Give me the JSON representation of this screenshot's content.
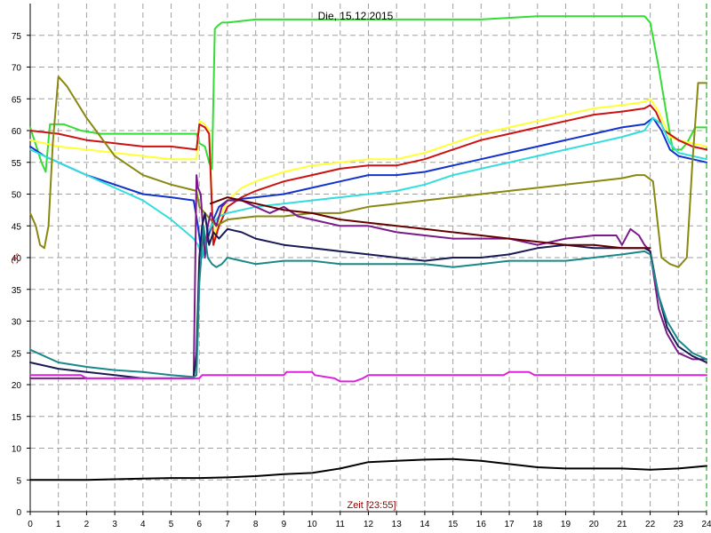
{
  "chart_data": {
    "type": "line",
    "title": "Die, 15.12.2015",
    "xlabel": "Zeit [23:55]",
    "ylabel": "°C",
    "xlim": [
      0,
      24
    ],
    "ylim": [
      0,
      80
    ],
    "x_ticks": [
      "0",
      "1",
      "2",
      "3",
      "4",
      "5",
      "6",
      "7",
      "8",
      "9",
      "10",
      "11",
      "12",
      "13",
      "14",
      "15",
      "16",
      "17",
      "18",
      "19",
      "20",
      "21",
      "22",
      "23",
      "24"
    ],
    "y_ticks": [
      "0",
      "5",
      "10",
      "15",
      "20",
      "25",
      "30",
      "35",
      "40",
      "45",
      "50",
      "55",
      "60",
      "65",
      "70",
      "75"
    ],
    "grid": true,
    "background": "#ffffff",
    "axis_color": "#000000",
    "grid_color": "#a0a0a0",
    "series": [
      {
        "color": "#33dd33",
        "x": [
          0,
          0.4,
          0.55,
          0.7,
          1.2,
          1.8,
          2.5,
          3,
          4,
          5,
          5.9,
          6.0,
          6.2,
          6.35,
          6.45,
          6.55,
          6.65,
          6.8,
          7,
          8,
          10,
          12,
          14,
          16,
          18,
          20,
          21,
          21.8,
          22.0,
          22.3,
          22.6,
          22.8,
          23.1,
          23.3,
          23.6,
          24
        ],
        "y": [
          60.5,
          55,
          53.5,
          61,
          61,
          60,
          59.5,
          59.5,
          59.5,
          59.5,
          59.5,
          58,
          57.5,
          55,
          54,
          76,
          76.5,
          77,
          77,
          77.5,
          77.5,
          77.5,
          77.5,
          77.5,
          78,
          78,
          78,
          78,
          77,
          70,
          62,
          57,
          57,
          58,
          60.5,
          60.5
        ]
      },
      {
        "color": "#ffff33",
        "x": [
          0,
          1,
          2,
          3,
          4,
          5,
          5.9,
          6.0,
          6.2,
          6.35,
          6.5,
          6.7,
          7,
          7.5,
          8,
          9,
          10,
          11,
          12,
          13,
          14,
          15,
          16,
          17,
          18,
          19,
          20,
          21,
          21.8,
          22.0,
          22.3,
          22.7,
          23,
          23.5,
          24
        ],
        "y": [
          58.5,
          57.5,
          57,
          56.5,
          56,
          55.5,
          55.5,
          61.5,
          61,
          60,
          43,
          46,
          49,
          51,
          52,
          53.5,
          54.5,
          55,
          55.5,
          55.5,
          56.5,
          58,
          59.5,
          60.5,
          61.5,
          62.5,
          63.5,
          64,
          64.5,
          65,
          63,
          59,
          58.5,
          58,
          57.5
        ]
      },
      {
        "color": "#cc1111",
        "x": [
          0,
          1,
          2,
          3,
          4,
          5,
          5.9,
          6.0,
          6.2,
          6.35,
          6.5,
          6.7,
          7,
          7.5,
          8,
          9,
          10,
          11,
          12,
          13,
          14,
          15,
          16,
          17,
          18,
          19,
          20,
          21,
          21.8,
          22.0,
          22.2,
          22.5,
          23,
          23.5,
          24
        ],
        "y": [
          60,
          59.5,
          58.5,
          58,
          57.5,
          57.5,
          57,
          61,
          60.5,
          59.5,
          42,
          45,
          48,
          49.5,
          50.5,
          52,
          53,
          54,
          54.5,
          54.5,
          55.5,
          57,
          58.5,
          59.5,
          60.5,
          61.5,
          62.5,
          63,
          63.5,
          64,
          63,
          60,
          58.5,
          57.5,
          57
        ]
      },
      {
        "color": "#1133cc",
        "x": [
          0,
          0.5,
          1,
          2,
          3,
          4,
          5,
          5.8,
          5.95,
          6.1,
          6.3,
          6.5,
          6.7,
          7,
          8,
          9,
          10,
          11,
          12,
          13,
          14,
          15,
          16,
          17,
          18,
          19,
          20,
          21,
          21.8,
          22.1,
          22.4,
          22.7,
          23,
          23.5,
          24
        ],
        "y": [
          57.5,
          56,
          55,
          53,
          51.5,
          50,
          49.5,
          49,
          45,
          40,
          43,
          46,
          48,
          49,
          49.5,
          50,
          51,
          52,
          53,
          53,
          53.5,
          54.5,
          55.5,
          56.5,
          57.5,
          58.5,
          59.5,
          60.5,
          61,
          62,
          60,
          57,
          56,
          55.5,
          55
        ]
      },
      {
        "color": "#33dddd",
        "x": [
          0,
          1,
          2,
          3,
          4,
          5,
          5.8,
          5.95,
          6.1,
          6.3,
          6.5,
          6.7,
          7,
          7.5,
          8,
          9,
          10,
          11,
          12,
          13,
          14,
          15,
          16,
          17,
          18,
          19,
          20,
          21,
          21.8,
          22.1,
          22.4,
          22.7,
          23,
          23.5,
          24
        ],
        "y": [
          57,
          55,
          53,
          51,
          49,
          46,
          43,
          42,
          40,
          44,
          45.5,
          46.5,
          47,
          47.5,
          48,
          48.5,
          49,
          49.5,
          50,
          50.5,
          51.5,
          53,
          54,
          55,
          56,
          57,
          58,
          59,
          60,
          62,
          61,
          58,
          56.5,
          56,
          55.5
        ]
      },
      {
        "color": "#888811",
        "x": [
          0,
          0.2,
          0.35,
          0.5,
          0.65,
          0.8,
          1,
          1.3,
          2,
          3,
          4,
          5,
          5.9,
          6.0,
          6.2,
          6.4,
          6.6,
          7,
          8,
          9,
          10,
          11,
          12,
          13,
          14,
          15,
          16,
          17,
          18,
          19,
          20,
          21,
          21.5,
          21.8,
          22.1,
          22.4,
          22.7,
          23,
          23.3,
          23.5,
          23.7,
          24
        ],
        "y": [
          47,
          45,
          42,
          41.5,
          45,
          58,
          68.5,
          67,
          62,
          56,
          53,
          51.5,
          50.5,
          48,
          47,
          46,
          45,
          46,
          46.5,
          46.5,
          47,
          47,
          48,
          48.5,
          49,
          49.5,
          50,
          50.5,
          51,
          51.5,
          52,
          52.5,
          53,
          53,
          52,
          40,
          39,
          38.5,
          40,
          55,
          67.5,
          67.5
        ]
      },
      {
        "color": "#7a1a8a",
        "x": [
          0,
          5.8,
          5.9,
          5.95,
          6.05,
          6.2,
          6.3,
          6.4,
          6.5,
          6.6,
          6.8,
          7,
          7.5,
          8,
          8.5,
          9,
          9.5,
          10,
          11,
          12,
          13,
          14,
          15,
          16,
          17,
          18,
          19,
          20,
          20.8,
          21.0,
          21.3,
          21.6,
          21.8,
          22.0,
          22.3,
          22.6,
          23,
          23.5,
          24
        ],
        "y": [
          21,
          21,
          53,
          51,
          50,
          40,
          45,
          47,
          46,
          45,
          48,
          49,
          49,
          48,
          47,
          48,
          46.5,
          46,
          45,
          45,
          44,
          43.5,
          43,
          43,
          43,
          42,
          43,
          43.5,
          43.5,
          42,
          44.5,
          43.5,
          42,
          41,
          32,
          28,
          25,
          24,
          24
        ]
      },
      {
        "color": "#1a1a55",
        "x": [
          0,
          1,
          2,
          3,
          4,
          5,
          5.8,
          5.9,
          6.0,
          6.1,
          6.2,
          6.35,
          6.5,
          6.7,
          7,
          7.5,
          8,
          9,
          10,
          11,
          12,
          13,
          14,
          15,
          16,
          17,
          18,
          19,
          20,
          21,
          21.8,
          22.0,
          22.3,
          22.6,
          23,
          23.5,
          24
        ],
        "y": [
          23.5,
          22.5,
          22,
          21.5,
          21,
          21,
          21,
          25,
          40,
          45,
          47,
          42,
          44,
          43,
          44.5,
          44,
          43,
          42,
          41.5,
          41,
          40.5,
          40,
          39.5,
          40,
          40,
          40.5,
          41.5,
          42,
          41.5,
          41.5,
          41.5,
          41,
          34,
          29,
          26,
          24.5,
          23.5
        ]
      },
      {
        "color": "#1a8888",
        "x": [
          0,
          1,
          2,
          3,
          4,
          5,
          5.8,
          5.9,
          6.0,
          6.15,
          6.3,
          6.45,
          6.6,
          6.8,
          7,
          7.5,
          8,
          9,
          10,
          11,
          12,
          13,
          14,
          15,
          16,
          17,
          18,
          19,
          20,
          21,
          21.8,
          22.0,
          22.3,
          22.6,
          23,
          23.5,
          24
        ],
        "y": [
          25.5,
          23.5,
          22.8,
          22.3,
          22,
          21.5,
          21.2,
          21.5,
          36,
          45,
          40,
          39,
          38.5,
          39,
          40,
          39.5,
          39,
          39.5,
          39.5,
          39,
          39,
          39,
          39,
          38.5,
          39,
          39.5,
          39.5,
          39.5,
          40,
          40.5,
          41,
          40.5,
          34,
          30,
          27,
          25,
          24
        ]
      },
      {
        "color": "#660000",
        "x": [
          6.4,
          7,
          8,
          9,
          10,
          11,
          12,
          13,
          14,
          15,
          16,
          17,
          18,
          19,
          20,
          21,
          22
        ],
        "y": [
          48.5,
          49.5,
          48.5,
          47.5,
          47,
          46,
          45.5,
          45,
          44.5,
          44,
          43.5,
          43,
          42.5,
          42,
          42,
          41.5,
          41.5
        ]
      },
      {
        "color": "#dd22dd",
        "x": [
          0,
          1.8,
          2.0,
          5.8,
          6.0,
          6.1,
          6.4,
          8,
          9,
          9.1,
          10,
          10.1,
          10.8,
          11.0,
          11.5,
          11.8,
          12.0,
          16.8,
          17.0,
          17.7,
          17.9,
          24
        ],
        "y": [
          21.5,
          21.5,
          21,
          21,
          21,
          21.5,
          21.5,
          21.5,
          21.5,
          22,
          22,
          21.5,
          21,
          20.5,
          20.5,
          21,
          21.5,
          21.5,
          22,
          22,
          21.5,
          21.5
        ]
      },
      {
        "color": "#000000",
        "x": [
          0,
          1,
          2,
          3,
          4,
          5,
          6,
          7,
          8,
          9,
          10,
          11,
          12,
          13,
          14,
          15,
          16,
          17,
          18,
          19,
          20,
          21,
          22,
          23,
          24
        ],
        "y": [
          5,
          5,
          5,
          5.1,
          5.2,
          5.3,
          5.3,
          5.4,
          5.6,
          5.9,
          6.1,
          6.8,
          7.8,
          8,
          8.2,
          8.3,
          8,
          7.5,
          7,
          6.8,
          6.8,
          6.8,
          6.6,
          6.8,
          7.2
        ]
      }
    ]
  }
}
